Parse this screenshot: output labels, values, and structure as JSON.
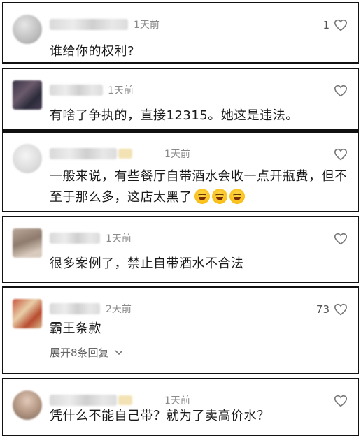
{
  "comments": [
    {
      "time": "1天前",
      "text": "谁给你的权利?",
      "likes": "1"
    },
    {
      "time": "1天前",
      "text": "有啥了争执的，直接12315。她这是违法。",
      "likes": ""
    },
    {
      "time": "1天前",
      "text": "一般来说，有些餐厅自带酒水会收一点开瓶费，但不至于那么多，这店太黑了",
      "likes": "",
      "emoji_count": 3,
      "emoji_icon": "laughing-crying-emoji"
    },
    {
      "time": "1天前",
      "text": "很多案例了，禁止自带酒水不合法",
      "likes": ""
    },
    {
      "time": "2天前",
      "text": "霸王条款",
      "likes": "73",
      "replies": "展开8条回复"
    },
    {
      "time": "1天前",
      "text": "凭什么不能自己带？就为了卖高价水？",
      "likes": ""
    }
  ],
  "icons": {
    "like": "heart-outline-icon",
    "expand": "chevron-down-icon"
  },
  "colors": {
    "border": "#111111",
    "time": "#8a8a8a",
    "text": "#1a1a1a"
  }
}
